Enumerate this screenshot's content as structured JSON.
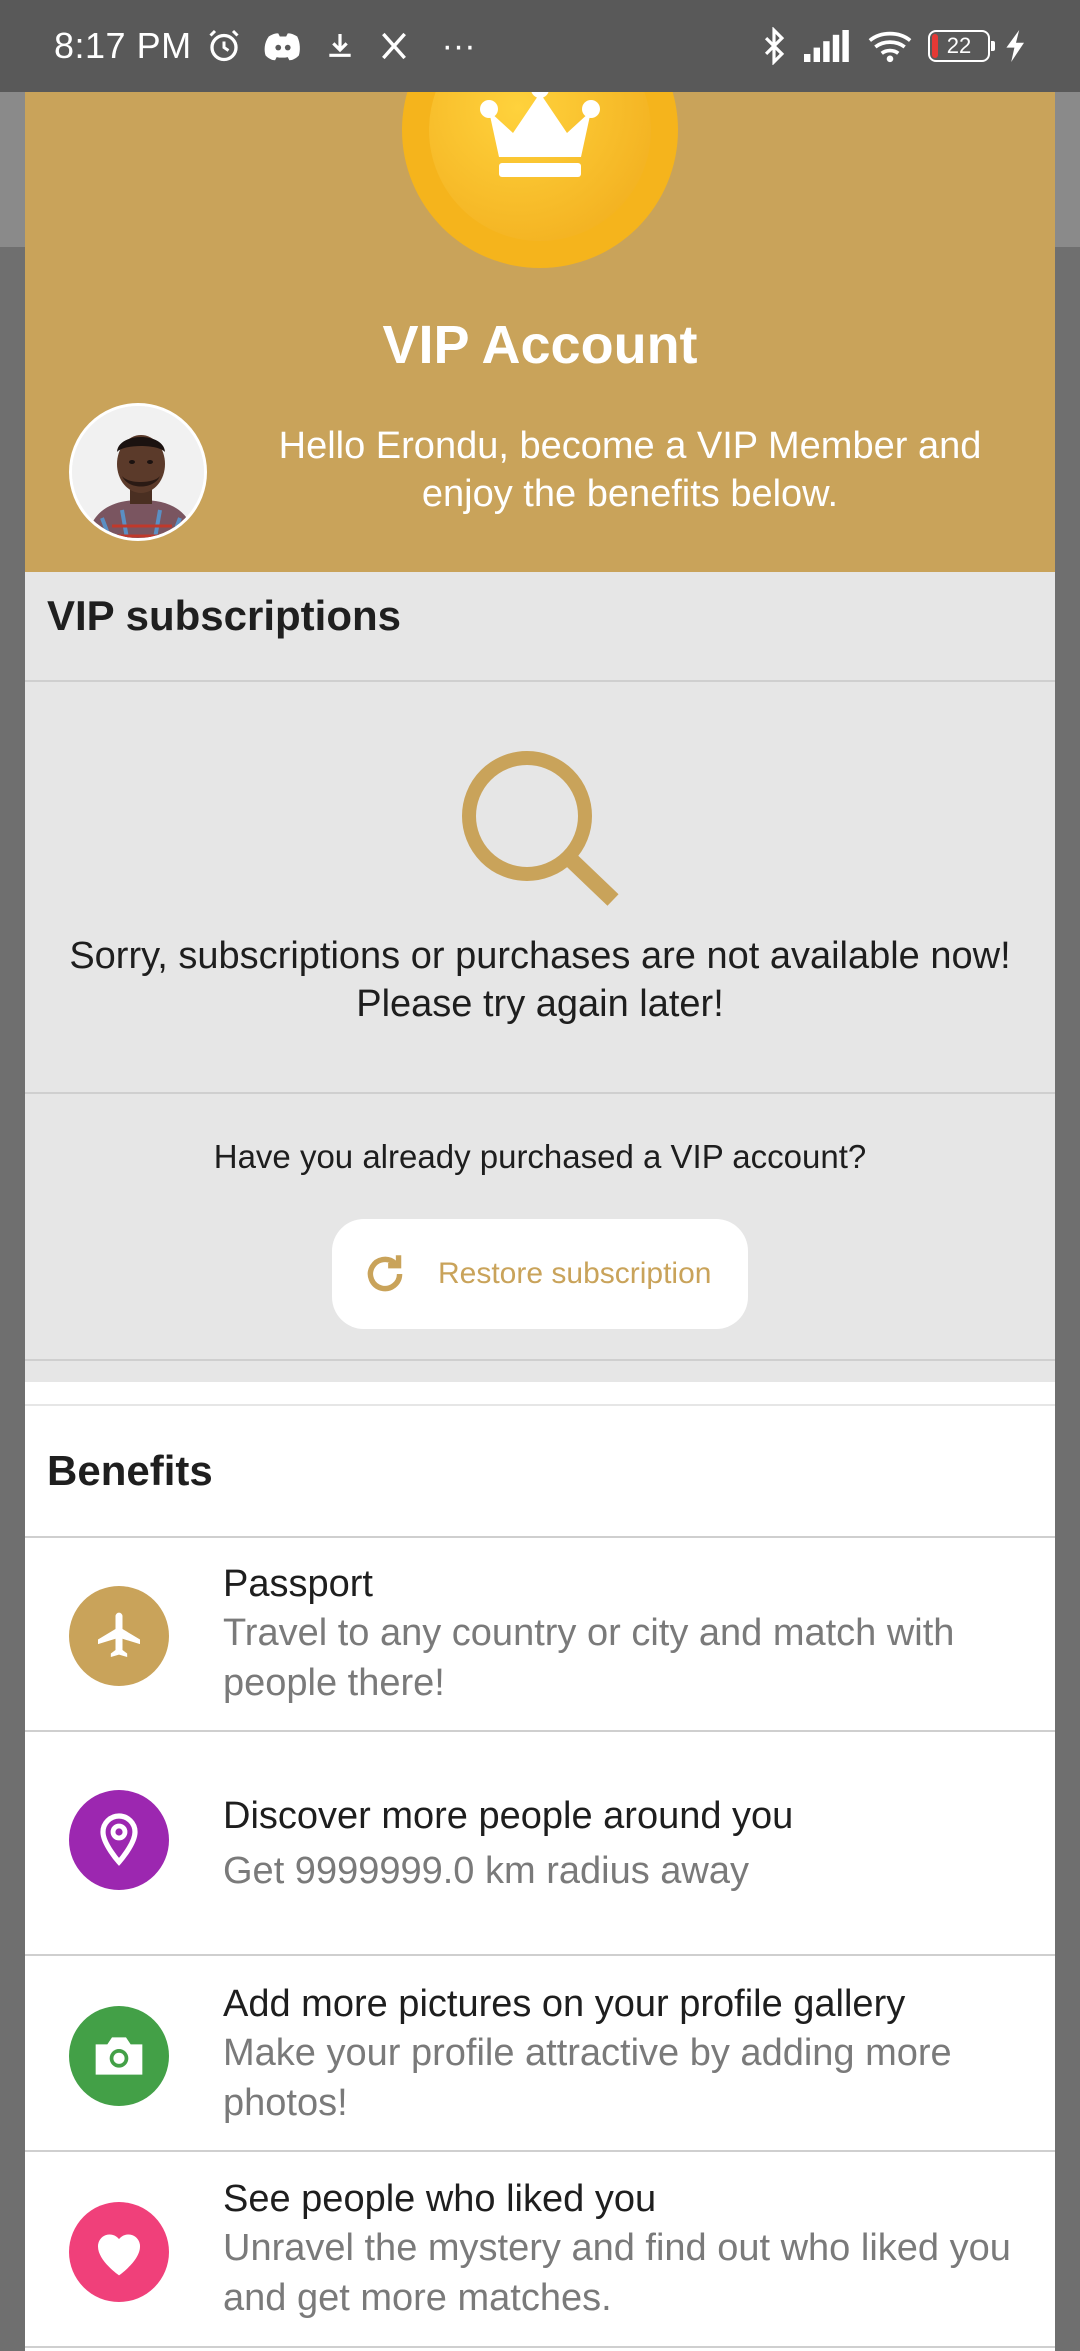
{
  "status_bar": {
    "time": "8:17 PM",
    "more": "···",
    "battery": "22",
    "icons_left": [
      "alarm-icon",
      "discord-icon",
      "download-icon",
      "x-icon"
    ],
    "icons_right": [
      "bluetooth-icon",
      "signal-icon",
      "wifi-icon",
      "battery-icon",
      "charging-icon"
    ]
  },
  "header": {
    "title": "VIP Account",
    "greeting": "Hello Erondu, become a VIP Member and enjoy the benefits below."
  },
  "subscriptions": {
    "title": "VIP subscriptions",
    "unavailable_line1": "Sorry, subscriptions or purchases are not available now!",
    "unavailable_line2": "Please try again later!",
    "already_purchased": "Have you already purchased a VIP account?",
    "restore_label": "Restore subscription"
  },
  "benefits": {
    "title": "Benefits",
    "items": [
      {
        "title": "Passport",
        "desc": "Travel to any country or city and match with people there!",
        "icon": "airplane-icon",
        "color": "#c9a35a"
      },
      {
        "title": "Discover more people around you",
        "desc": "Get 9999999.0 km radius away",
        "icon": "location-pin-icon",
        "color": "#9c27b0"
      },
      {
        "title": "Add more pictures on your profile gallery",
        "desc": "Make your profile attractive by adding more photos!",
        "icon": "camera-icon",
        "color": "#43a047"
      },
      {
        "title": "See people who liked you",
        "desc": "Unravel the mystery and find out who liked you and get more matches.",
        "icon": "heart-icon",
        "color": "#f0407a"
      }
    ]
  },
  "colors": {
    "accent_gold": "#c9a35a",
    "coin": "#f5b41c",
    "section_gray": "#e6e6e6"
  }
}
